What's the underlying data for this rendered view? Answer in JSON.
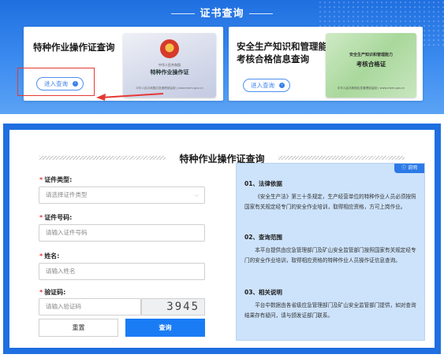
{
  "top": {
    "title": "证书查询",
    "card1": {
      "title": "特种作业操作证查询",
      "enter_label": "进入查询",
      "image": {
        "line1": "中华人民共和国",
        "line2": "特种作业操作证",
        "line3": "中华人民共和国应急管理部监制 | www.mem.gov.cn"
      }
    },
    "card2": {
      "title": "安全生产知识和管理能力考核合格信息查询",
      "enter_label": "进入查询",
      "image": {
        "line1": "安全生产知识和管理能力",
        "line2": "考核合格证",
        "line3": "中华人民共和国应急管理部监制 | www.mem.gov.cn"
      }
    }
  },
  "form": {
    "title": "特种作业操作证查询",
    "cert_type": {
      "label": "证件类型:",
      "placeholder": "请选择证件类型"
    },
    "cert_no": {
      "label": "证件号码:",
      "placeholder": "请输入证件号码"
    },
    "name": {
      "label": "姓名:",
      "placeholder": "请输入姓名"
    },
    "captcha": {
      "label": "验证码:",
      "placeholder": "请输入验证码",
      "code": "3945"
    },
    "reset_label": "重置",
    "query_label": "查询"
  },
  "notice": {
    "tag": "ⓘ 说明",
    "s1_title": "01、法律依据",
    "s1_text": "《安全生产法》第三十条规定，生产经营单位的特种作业人员必须按照国家有关规定经专门的安全作业培训，取得相应资格，方可上岗作业。",
    "s2_title": "02、查询范围",
    "s2_text": "本平台提供由应急管理部门及矿山安全监管部门按照国家有关规定经专门的安全作业培训，取得相应资格的特种作业人员操作证信息查询。",
    "s3_title": "03、相关说明",
    "s3_text": "平台中数据由各省级应急管理部门及矿山安全监管部门提供，如对查询结果存有疑问，请与颁发证部门联系。"
  }
}
